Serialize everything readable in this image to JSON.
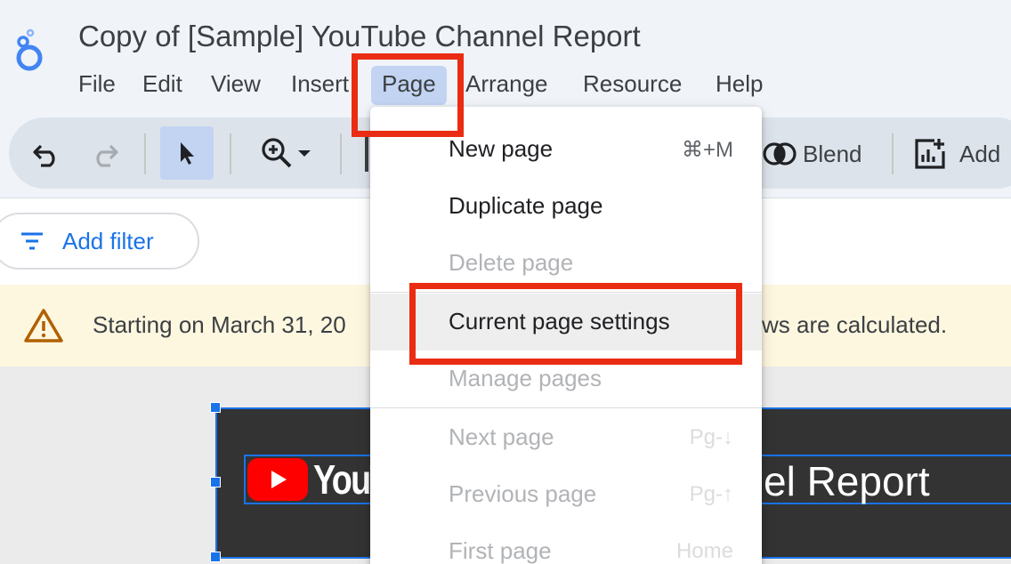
{
  "app": {
    "document_title": "Copy of [Sample] YouTube Channel Report",
    "logo_icon": "looker-studio-logo"
  },
  "menubar": {
    "items": [
      "File",
      "Edit",
      "View",
      "Insert",
      "Page",
      "Arrange",
      "Resource",
      "Help"
    ],
    "active": "Page"
  },
  "toolbar": {
    "blend_label": "Blend",
    "add_chart_label": "Add"
  },
  "filterbar": {
    "add_filter_label": "Add filter"
  },
  "banner": {
    "text_left": "Starting on March 31, 20",
    "text_right": "ws are calculated."
  },
  "canvas": {
    "youtube_wordmark": "YouT",
    "report_title_visible": "el Report"
  },
  "page_menu": {
    "new_page": {
      "label": "New page",
      "shortcut": "⌘+M"
    },
    "duplicate_page": {
      "label": "Duplicate page"
    },
    "delete_page": {
      "label": "Delete page"
    },
    "current_page_settings": {
      "label": "Current page settings"
    },
    "manage_pages": {
      "label": "Manage pages"
    },
    "next_page": {
      "label": "Next page",
      "shortcut": "Pg-↓"
    },
    "previous_page": {
      "label": "Previous page",
      "shortcut": "Pg-↑"
    },
    "first_page": {
      "label": "First page",
      "shortcut": "Home"
    }
  },
  "colors": {
    "accent_blue": "#1a73e8",
    "highlight_red": "#ea2c12",
    "banner_bg": "#fef7e0",
    "warning_icon": "#b06000"
  }
}
